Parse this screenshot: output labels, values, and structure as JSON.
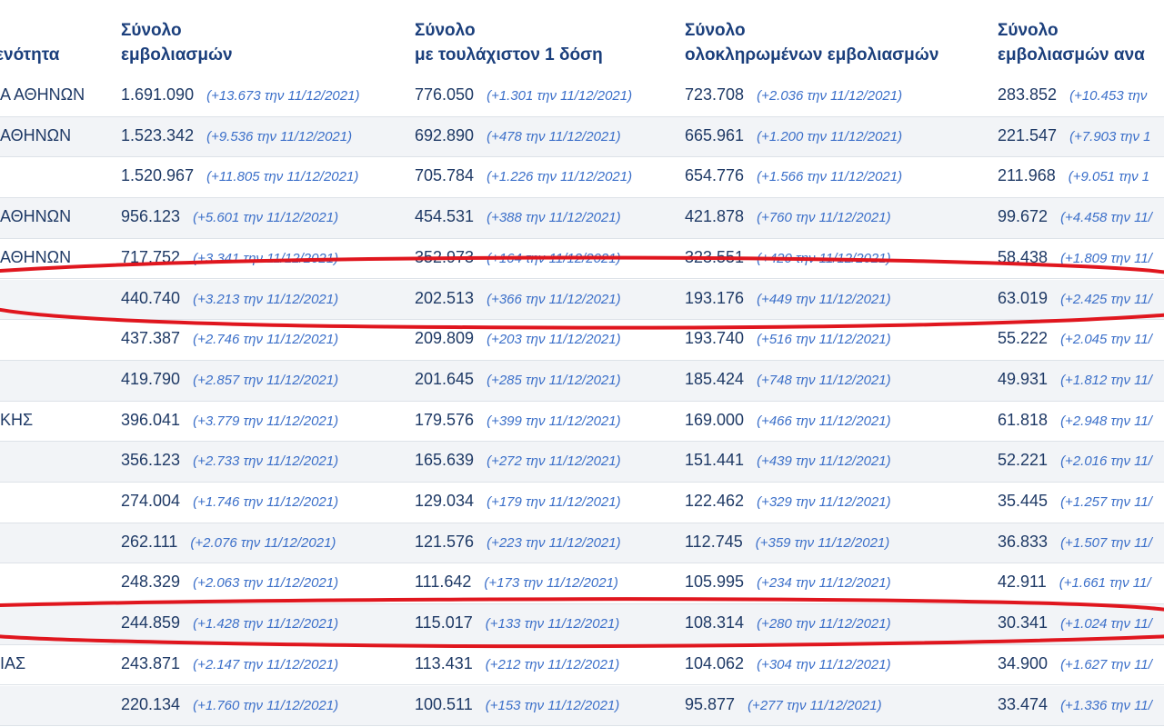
{
  "columns": [
    {
      "title": "ενότητα"
    },
    {
      "title": "Σύνολο\nεμβολιασμών"
    },
    {
      "title": "Σύνολο\nμε τουλάχιστον 1 δόση"
    },
    {
      "title": "Σύνολο\nολοκληρωμένων εμβολιασμών"
    },
    {
      "title": "Σύνολο\nεμβολιασμών ανα"
    }
  ],
  "rows": [
    {
      "region": "Α ΑΘΗΝΩΝ",
      "total": "1.691.090",
      "total_delta": "(+13.673 την 11/12/2021)",
      "one_dose": "776.050",
      "one_dose_delta": "(+1.301 την 11/12/2021)",
      "completed": "723.708",
      "completed_delta": "(+2.036 την 11/12/2021)",
      "booster": "283.852",
      "booster_delta": "(+10.453 την"
    },
    {
      "region": "ΑΘΗΝΩΝ",
      "total": "1.523.342",
      "total_delta": "(+9.536 την 11/12/2021)",
      "one_dose": "692.890",
      "one_dose_delta": "(+478 την 11/12/2021)",
      "completed": "665.961",
      "completed_delta": "(+1.200 την 11/12/2021)",
      "booster": "221.547",
      "booster_delta": "(+7.903 την 1"
    },
    {
      "region": "",
      "total": "1.520.967",
      "total_delta": "(+11.805 την 11/12/2021)",
      "one_dose": "705.784",
      "one_dose_delta": "(+1.226 την 11/12/2021)",
      "completed": "654.776",
      "completed_delta": "(+1.566 την 11/12/2021)",
      "booster": "211.968",
      "booster_delta": "(+9.051 την 1"
    },
    {
      "region": "ΑΘΗΝΩΝ",
      "total": "956.123",
      "total_delta": "(+5.601 την 11/12/2021)",
      "one_dose": "454.531",
      "one_dose_delta": "(+388 την 11/12/2021)",
      "completed": "421.878",
      "completed_delta": "(+760 την 11/12/2021)",
      "booster": "99.672",
      "booster_delta": "(+4.458 την 11/"
    },
    {
      "region": "ΑΘΗΝΩΝ",
      "total": "717.752",
      "total_delta": "(+3.341 την 11/12/2021)",
      "one_dose": "352.973",
      "one_dose_delta": "(+164 την 11/12/2021)",
      "completed": "323.551",
      "completed_delta": "(+420 την 11/12/2021)",
      "booster": "58.438",
      "booster_delta": "(+1.809 την 11/"
    },
    {
      "region": "",
      "total": "440.740",
      "total_delta": "(+3.213 την 11/12/2021)",
      "one_dose": "202.513",
      "one_dose_delta": "(+366 την 11/12/2021)",
      "completed": "193.176",
      "completed_delta": "(+449 την 11/12/2021)",
      "booster": "63.019",
      "booster_delta": "(+2.425 την 11/"
    },
    {
      "region": "",
      "total": "437.387",
      "total_delta": "(+2.746 την 11/12/2021)",
      "one_dose": "209.809",
      "one_dose_delta": "(+203 την 11/12/2021)",
      "completed": "193.740",
      "completed_delta": "(+516 την 11/12/2021)",
      "booster": "55.222",
      "booster_delta": "(+2.045 την 11/"
    },
    {
      "region": "",
      "total": "419.790",
      "total_delta": "(+2.857 την 11/12/2021)",
      "one_dose": "201.645",
      "one_dose_delta": "(+285 την 11/12/2021)",
      "completed": "185.424",
      "completed_delta": "(+748 την 11/12/2021)",
      "booster": "49.931",
      "booster_delta": "(+1.812 την 11/"
    },
    {
      "region": "ΚΗΣ",
      "total": "396.041",
      "total_delta": "(+3.779 την 11/12/2021)",
      "one_dose": "179.576",
      "one_dose_delta": "(+399 την 11/12/2021)",
      "completed": "169.000",
      "completed_delta": "(+466 την 11/12/2021)",
      "booster": "61.818",
      "booster_delta": "(+2.948 την 11/"
    },
    {
      "region": "",
      "total": "356.123",
      "total_delta": "(+2.733 την 11/12/2021)",
      "one_dose": "165.639",
      "one_dose_delta": "(+272 την 11/12/2021)",
      "completed": "151.441",
      "completed_delta": "(+439 την 11/12/2021)",
      "booster": "52.221",
      "booster_delta": "(+2.016 την 11/"
    },
    {
      "region": "",
      "total": "274.004",
      "total_delta": "(+1.746 την 11/12/2021)",
      "one_dose": "129.034",
      "one_dose_delta": "(+179 την 11/12/2021)",
      "completed": "122.462",
      "completed_delta": "(+329 την 11/12/2021)",
      "booster": "35.445",
      "booster_delta": "(+1.257 την 11/"
    },
    {
      "region": "",
      "total": "262.111",
      "total_delta": "(+2.076 την 11/12/2021)",
      "one_dose": "121.576",
      "one_dose_delta": "(+223 την 11/12/2021)",
      "completed": "112.745",
      "completed_delta": "(+359 την 11/12/2021)",
      "booster": "36.833",
      "booster_delta": "(+1.507 την 11/"
    },
    {
      "region": "",
      "total": "248.329",
      "total_delta": "(+2.063 την 11/12/2021)",
      "one_dose": "111.642",
      "one_dose_delta": "(+173 την 11/12/2021)",
      "completed": "105.995",
      "completed_delta": "(+234 την 11/12/2021)",
      "booster": "42.911",
      "booster_delta": "(+1.661 την 11/"
    },
    {
      "region": "",
      "total": "244.859",
      "total_delta": "(+1.428 την 11/12/2021)",
      "one_dose": "115.017",
      "one_dose_delta": "(+133 την 11/12/2021)",
      "completed": "108.314",
      "completed_delta": "(+280 την 11/12/2021)",
      "booster": "30.341",
      "booster_delta": "(+1.024 την 11/"
    },
    {
      "region": "ΙΑΣ",
      "total": "243.871",
      "total_delta": "(+2.147 την 11/12/2021)",
      "one_dose": "113.431",
      "one_dose_delta": "(+212 την 11/12/2021)",
      "completed": "104.062",
      "completed_delta": "(+304 την 11/12/2021)",
      "booster": "34.900",
      "booster_delta": "(+1.627 την 11/"
    },
    {
      "region": "",
      "total": "220.134",
      "total_delta": "(+1.760 την 11/12/2021)",
      "one_dose": "100.511",
      "one_dose_delta": "(+153 την 11/12/2021)",
      "completed": "95.877",
      "completed_delta": "(+277 την 11/12/2021)",
      "booster": "33.474",
      "booster_delta": "(+1.336 την 11/"
    }
  ],
  "colors": {
    "header_text": "#1b3f7c",
    "body_text": "#1f3a66",
    "delta_text": "#3b6fc9",
    "row_alt_bg": "#f2f4f7",
    "annotation_red": "#e0161e"
  }
}
